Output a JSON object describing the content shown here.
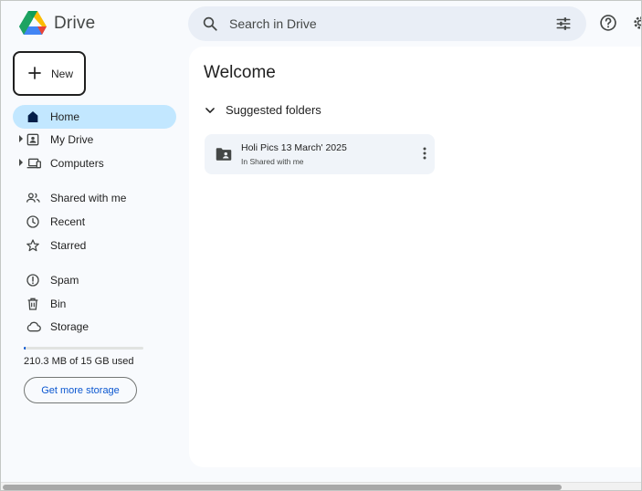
{
  "app": {
    "name": "Drive"
  },
  "search": {
    "placeholder": "Search in Drive"
  },
  "new_button": {
    "label": "New"
  },
  "sidebar": {
    "items": [
      {
        "label": "Home",
        "icon": "home-icon",
        "active": true
      },
      {
        "label": "My Drive",
        "icon": "my-drive-icon",
        "expandable": true
      },
      {
        "label": "Computers",
        "icon": "computers-icon",
        "expandable": true
      },
      {
        "label": "Shared with me",
        "icon": "people-icon"
      },
      {
        "label": "Recent",
        "icon": "clock-icon"
      },
      {
        "label": "Starred",
        "icon": "star-icon"
      },
      {
        "label": "Spam",
        "icon": "spam-icon"
      },
      {
        "label": "Bin",
        "icon": "bin-icon"
      },
      {
        "label": "Storage",
        "icon": "cloud-icon"
      }
    ]
  },
  "storage": {
    "used_text": "210.3 MB of 15 GB used",
    "used_fraction": 0.014,
    "button_label": "Get more storage"
  },
  "main": {
    "title": "Welcome",
    "section_title": "Suggested folders",
    "folders": [
      {
        "name": "Holi Pics 13 March' 2025",
        "location": "In Shared with me"
      }
    ]
  },
  "colors": {
    "accent": "#0b57d0",
    "active_nav": "#c2e7ff",
    "search_bg": "#e9eef6",
    "sidebar_bg": "#f8fafd"
  }
}
